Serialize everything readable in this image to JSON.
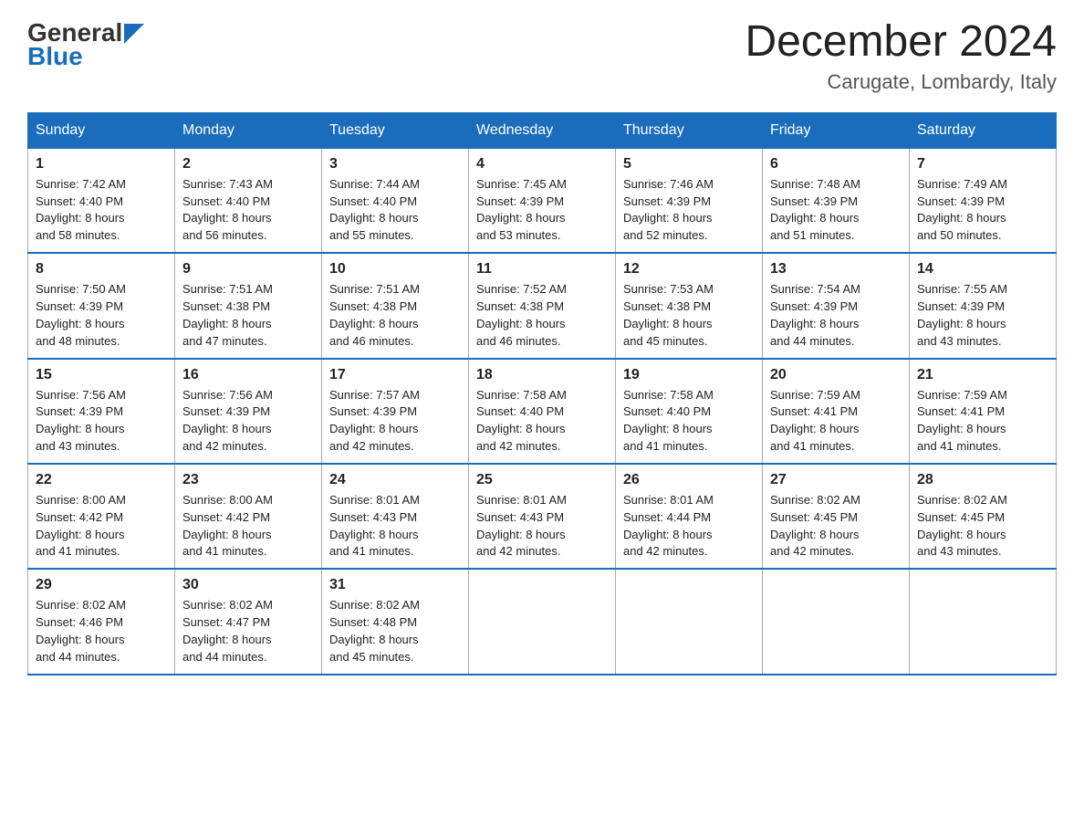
{
  "logo": {
    "general": "General",
    "blue": "Blue"
  },
  "header": {
    "month_year": "December 2024",
    "location": "Carugate, Lombardy, Italy"
  },
  "days_of_week": [
    "Sunday",
    "Monday",
    "Tuesday",
    "Wednesday",
    "Thursday",
    "Friday",
    "Saturday"
  ],
  "weeks": [
    [
      {
        "day": "1",
        "sunrise": "7:42 AM",
        "sunset": "4:40 PM",
        "daylight": "8 hours and 58 minutes."
      },
      {
        "day": "2",
        "sunrise": "7:43 AM",
        "sunset": "4:40 PM",
        "daylight": "8 hours and 56 minutes."
      },
      {
        "day": "3",
        "sunrise": "7:44 AM",
        "sunset": "4:40 PM",
        "daylight": "8 hours and 55 minutes."
      },
      {
        "day": "4",
        "sunrise": "7:45 AM",
        "sunset": "4:39 PM",
        "daylight": "8 hours and 53 minutes."
      },
      {
        "day": "5",
        "sunrise": "7:46 AM",
        "sunset": "4:39 PM",
        "daylight": "8 hours and 52 minutes."
      },
      {
        "day": "6",
        "sunrise": "7:48 AM",
        "sunset": "4:39 PM",
        "daylight": "8 hours and 51 minutes."
      },
      {
        "day": "7",
        "sunrise": "7:49 AM",
        "sunset": "4:39 PM",
        "daylight": "8 hours and 50 minutes."
      }
    ],
    [
      {
        "day": "8",
        "sunrise": "7:50 AM",
        "sunset": "4:39 PM",
        "daylight": "8 hours and 48 minutes."
      },
      {
        "day": "9",
        "sunrise": "7:51 AM",
        "sunset": "4:38 PM",
        "daylight": "8 hours and 47 minutes."
      },
      {
        "day": "10",
        "sunrise": "7:51 AM",
        "sunset": "4:38 PM",
        "daylight": "8 hours and 46 minutes."
      },
      {
        "day": "11",
        "sunrise": "7:52 AM",
        "sunset": "4:38 PM",
        "daylight": "8 hours and 46 minutes."
      },
      {
        "day": "12",
        "sunrise": "7:53 AM",
        "sunset": "4:38 PM",
        "daylight": "8 hours and 45 minutes."
      },
      {
        "day": "13",
        "sunrise": "7:54 AM",
        "sunset": "4:39 PM",
        "daylight": "8 hours and 44 minutes."
      },
      {
        "day": "14",
        "sunrise": "7:55 AM",
        "sunset": "4:39 PM",
        "daylight": "8 hours and 43 minutes."
      }
    ],
    [
      {
        "day": "15",
        "sunrise": "7:56 AM",
        "sunset": "4:39 PM",
        "daylight": "8 hours and 43 minutes."
      },
      {
        "day": "16",
        "sunrise": "7:56 AM",
        "sunset": "4:39 PM",
        "daylight": "8 hours and 42 minutes."
      },
      {
        "day": "17",
        "sunrise": "7:57 AM",
        "sunset": "4:39 PM",
        "daylight": "8 hours and 42 minutes."
      },
      {
        "day": "18",
        "sunrise": "7:58 AM",
        "sunset": "4:40 PM",
        "daylight": "8 hours and 42 minutes."
      },
      {
        "day": "19",
        "sunrise": "7:58 AM",
        "sunset": "4:40 PM",
        "daylight": "8 hours and 41 minutes."
      },
      {
        "day": "20",
        "sunrise": "7:59 AM",
        "sunset": "4:41 PM",
        "daylight": "8 hours and 41 minutes."
      },
      {
        "day": "21",
        "sunrise": "7:59 AM",
        "sunset": "4:41 PM",
        "daylight": "8 hours and 41 minutes."
      }
    ],
    [
      {
        "day": "22",
        "sunrise": "8:00 AM",
        "sunset": "4:42 PM",
        "daylight": "8 hours and 41 minutes."
      },
      {
        "day": "23",
        "sunrise": "8:00 AM",
        "sunset": "4:42 PM",
        "daylight": "8 hours and 41 minutes."
      },
      {
        "day": "24",
        "sunrise": "8:01 AM",
        "sunset": "4:43 PM",
        "daylight": "8 hours and 41 minutes."
      },
      {
        "day": "25",
        "sunrise": "8:01 AM",
        "sunset": "4:43 PM",
        "daylight": "8 hours and 42 minutes."
      },
      {
        "day": "26",
        "sunrise": "8:01 AM",
        "sunset": "4:44 PM",
        "daylight": "8 hours and 42 minutes."
      },
      {
        "day": "27",
        "sunrise": "8:02 AM",
        "sunset": "4:45 PM",
        "daylight": "8 hours and 42 minutes."
      },
      {
        "day": "28",
        "sunrise": "8:02 AM",
        "sunset": "4:45 PM",
        "daylight": "8 hours and 43 minutes."
      }
    ],
    [
      {
        "day": "29",
        "sunrise": "8:02 AM",
        "sunset": "4:46 PM",
        "daylight": "8 hours and 44 minutes."
      },
      {
        "day": "30",
        "sunrise": "8:02 AM",
        "sunset": "4:47 PM",
        "daylight": "8 hours and 44 minutes."
      },
      {
        "day": "31",
        "sunrise": "8:02 AM",
        "sunset": "4:48 PM",
        "daylight": "8 hours and 45 minutes."
      },
      null,
      null,
      null,
      null
    ]
  ],
  "labels": {
    "sunrise": "Sunrise:",
    "sunset": "Sunset:",
    "daylight": "Daylight:"
  }
}
